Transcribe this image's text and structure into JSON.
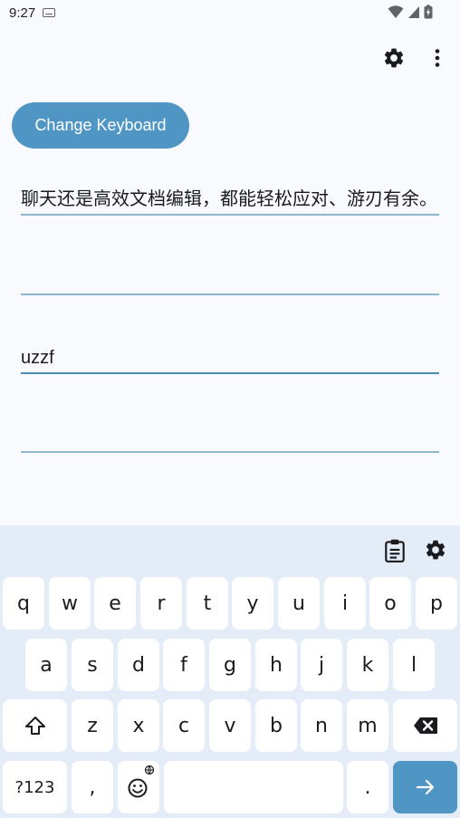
{
  "status_bar": {
    "time": "9:27"
  },
  "main": {
    "change_keyboard_label": "Change Keyboard",
    "fields": [
      {
        "value": "聊天还是高效文档编辑，都能轻松应对、游刃有余。"
      },
      {
        "value": ""
      },
      {
        "value": "uzzf"
      },
      {
        "value": ""
      }
    ]
  },
  "keyboard": {
    "row1": [
      "q",
      "w",
      "e",
      "r",
      "t",
      "y",
      "u",
      "i",
      "o",
      "p"
    ],
    "row2": [
      "a",
      "s",
      "d",
      "f",
      "g",
      "h",
      "j",
      "k",
      "l"
    ],
    "row3": [
      "z",
      "x",
      "c",
      "v",
      "b",
      "n",
      "m"
    ],
    "symbols_label": "?123",
    "comma_label": ",",
    "period_label": "."
  },
  "colors": {
    "accent": "#5096c5",
    "background": "#f8fafe",
    "keyboard_background": "#e4ecf8",
    "key": "#ffffff"
  }
}
